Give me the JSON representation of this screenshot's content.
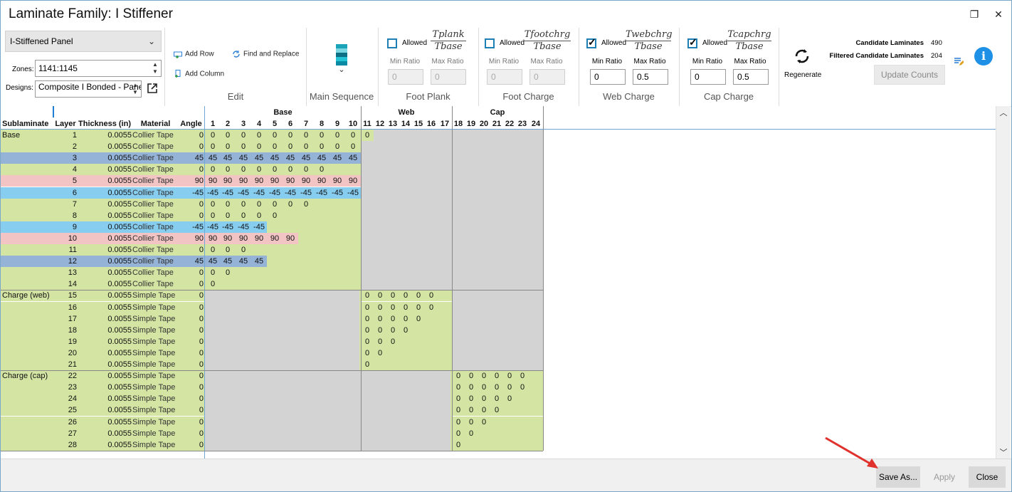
{
  "window": {
    "title": "Laminate Family: I Stiffener",
    "maximize_icon": "maximize-icon",
    "close_icon": "close-icon"
  },
  "ribbon": {
    "family_combo": "I-Stiffened Panel",
    "zones_label": "Zones:",
    "zones_value": "1141:1145",
    "designs_label": "Designs:",
    "designs_value": "Composite I Bonded - Panel Stiffener",
    "edit": {
      "add_row": "Add Row",
      "add_column": "Add Column",
      "find_replace": "Find and Replace",
      "label": "Edit"
    },
    "main_sequence_label": "Main Sequence",
    "ratio_groups": [
      {
        "label": "Foot Plank",
        "allowed": "Allowed",
        "checked": false,
        "num": "Tplank",
        "den": "Tbase",
        "min_label": "Min Ratio",
        "max_label": "Max Ratio",
        "min": "0",
        "max": "0"
      },
      {
        "label": "Foot Charge",
        "allowed": "Allowed",
        "checked": false,
        "num": "Tfootchrg",
        "den": "Tbase",
        "min_label": "Min Ratio",
        "max_label": "Max Ratio",
        "min": "0",
        "max": "0"
      },
      {
        "label": "Web Charge",
        "allowed": "Allowed",
        "checked": true,
        "num": "Twebchrg",
        "den": "Tbase",
        "min_label": "Min Ratio",
        "max_label": "Max Ratio",
        "min": "0",
        "max": "0.5"
      },
      {
        "label": "Cap Charge",
        "allowed": "Allowed",
        "checked": true,
        "num": "Tcapchrg",
        "den": "Tbase",
        "min_label": "Min Ratio",
        "max_label": "Max Ratio",
        "min": "0",
        "max": "0.5"
      }
    ],
    "regenerate": "Regenerate",
    "candidate_label": "Candidate Laminates",
    "candidate_value": "490",
    "filtered_label": "Filtered Candidate Laminates",
    "filtered_value": "204",
    "update_counts": "Update Counts"
  },
  "grid": {
    "group_headers": [
      "Base",
      "Web",
      "Cap"
    ],
    "col_headers": [
      "Sublaminate",
      "Layer",
      "Thickness (in)",
      "Material",
      "Angle"
    ],
    "seq_numbers": [
      "1",
      "2",
      "3",
      "4",
      "5",
      "6",
      "7",
      "8",
      "9",
      "10",
      "11",
      "12",
      "13",
      "14",
      "15",
      "16",
      "17",
      "18",
      "19",
      "20",
      "21",
      "22",
      "23",
      "24"
    ],
    "rows": [
      {
        "sub": "Base",
        "layer": "1",
        "thk": "0.0055",
        "mat": "Collier Tape",
        "angle": "0",
        "v": "0",
        "n": 11,
        "start": 1,
        "color": "#d3e4a3"
      },
      {
        "sub": "",
        "layer": "2",
        "thk": "0.0055",
        "mat": "Collier Tape",
        "angle": "0",
        "v": "0",
        "n": 10,
        "start": 1,
        "color": "#d3e4a3"
      },
      {
        "sub": "",
        "layer": "3",
        "thk": "0.0055",
        "mat": "Collier Tape",
        "angle": "45",
        "v": "45",
        "n": 10,
        "start": 1,
        "color": "#95b3d7"
      },
      {
        "sub": "",
        "layer": "4",
        "thk": "0.0055",
        "mat": "Collier Tape",
        "angle": "0",
        "v": "0",
        "n": 8,
        "start": 1,
        "color": "#d3e4a3"
      },
      {
        "sub": "",
        "layer": "5",
        "thk": "0.0055",
        "mat": "Collier Tape",
        "angle": "90",
        "v": "90",
        "n": 10,
        "start": 1,
        "color": "#f2c4c4"
      },
      {
        "sub": "",
        "layer": "6",
        "thk": "0.0055",
        "mat": "Collier Tape",
        "angle": "-45",
        "v": "-45",
        "n": 10,
        "start": 1,
        "color": "#87cdf0"
      },
      {
        "sub": "",
        "layer": "7",
        "thk": "0.0055",
        "mat": "Collier Tape",
        "angle": "0",
        "v": "0",
        "n": 7,
        "start": 1,
        "color": "#d3e4a3"
      },
      {
        "sub": "",
        "layer": "8",
        "thk": "0.0055",
        "mat": "Collier Tape",
        "angle": "0",
        "v": "0",
        "n": 5,
        "start": 1,
        "color": "#d3e4a3"
      },
      {
        "sub": "",
        "layer": "9",
        "thk": "0.0055",
        "mat": "Collier Tape",
        "angle": "-45",
        "v": "-45",
        "n": 4,
        "start": 1,
        "color": "#87cdf0"
      },
      {
        "sub": "",
        "layer": "10",
        "thk": "0.0055",
        "mat": "Collier Tape",
        "angle": "90",
        "v": "90",
        "n": 6,
        "start": 1,
        "color": "#f2c4c4"
      },
      {
        "sub": "",
        "layer": "11",
        "thk": "0.0055",
        "mat": "Collier Tape",
        "angle": "0",
        "v": "0",
        "n": 3,
        "start": 1,
        "color": "#d3e4a3"
      },
      {
        "sub": "",
        "layer": "12",
        "thk": "0.0055",
        "mat": "Collier Tape",
        "angle": "45",
        "v": "45",
        "n": 4,
        "start": 1,
        "color": "#95b3d7"
      },
      {
        "sub": "",
        "layer": "13",
        "thk": "0.0055",
        "mat": "Collier Tape",
        "angle": "0",
        "v": "0",
        "n": 2,
        "start": 1,
        "color": "#d3e4a3"
      },
      {
        "sub": "",
        "layer": "14",
        "thk": "0.0055",
        "mat": "Collier Tape",
        "angle": "0",
        "v": "0",
        "n": 1,
        "start": 1,
        "color": "#d3e4a3"
      },
      {
        "sub": "Charge (web)",
        "layer": "15",
        "thk": "0.0055",
        "mat": "Simple Tape",
        "angle": "0",
        "v": "0",
        "n": 6,
        "start": 11,
        "color": "#d3e4a3"
      },
      {
        "sub": "",
        "layer": "16",
        "thk": "0.0055",
        "mat": "Simple Tape",
        "angle": "0",
        "v": "0",
        "n": 6,
        "start": 11,
        "color": "#d3e4a3"
      },
      {
        "sub": "",
        "layer": "17",
        "thk": "0.0055",
        "mat": "Simple Tape",
        "angle": "0",
        "v": "0",
        "n": 5,
        "start": 11,
        "color": "#d3e4a3"
      },
      {
        "sub": "",
        "layer": "18",
        "thk": "0.0055",
        "mat": "Simple Tape",
        "angle": "0",
        "v": "0",
        "n": 4,
        "start": 11,
        "color": "#d3e4a3"
      },
      {
        "sub": "",
        "layer": "19",
        "thk": "0.0055",
        "mat": "Simple Tape",
        "angle": "0",
        "v": "0",
        "n": 3,
        "start": 11,
        "color": "#d3e4a3"
      },
      {
        "sub": "",
        "layer": "20",
        "thk": "0.0055",
        "mat": "Simple Tape",
        "angle": "0",
        "v": "0",
        "n": 2,
        "start": 11,
        "color": "#d3e4a3"
      },
      {
        "sub": "",
        "layer": "21",
        "thk": "0.0055",
        "mat": "Simple Tape",
        "angle": "0",
        "v": "0",
        "n": 1,
        "start": 11,
        "color": "#d3e4a3"
      },
      {
        "sub": "Charge (cap)",
        "layer": "22",
        "thk": "0.0055",
        "mat": "Simple Tape",
        "angle": "0",
        "v": "0",
        "n": 6,
        "start": 18,
        "color": "#d3e4a3"
      },
      {
        "sub": "",
        "layer": "23",
        "thk": "0.0055",
        "mat": "Simple Tape",
        "angle": "0",
        "v": "0",
        "n": 6,
        "start": 18,
        "color": "#d3e4a3"
      },
      {
        "sub": "",
        "layer": "24",
        "thk": "0.0055",
        "mat": "Simple Tape",
        "angle": "0",
        "v": "0",
        "n": 5,
        "start": 18,
        "color": "#d3e4a3"
      },
      {
        "sub": "",
        "layer": "25",
        "thk": "0.0055",
        "mat": "Simple Tape",
        "angle": "0",
        "v": "0",
        "n": 4,
        "start": 18,
        "color": "#d3e4a3"
      },
      {
        "sub": "",
        "layer": "26",
        "thk": "0.0055",
        "mat": "Simple Tape",
        "angle": "0",
        "v": "0",
        "n": 3,
        "start": 18,
        "color": "#d3e4a3"
      },
      {
        "sub": "",
        "layer": "27",
        "thk": "0.0055",
        "mat": "Simple Tape",
        "angle": "0",
        "v": "0",
        "n": 2,
        "start": 18,
        "color": "#d3e4a3"
      },
      {
        "sub": "",
        "layer": "28",
        "thk": "0.0055",
        "mat": "Simple Tape",
        "angle": "0",
        "v": "0",
        "n": 1,
        "start": 18,
        "color": "#d3e4a3"
      }
    ]
  },
  "footer": {
    "save_as": "Save As...",
    "apply": "Apply",
    "close": "Close"
  }
}
